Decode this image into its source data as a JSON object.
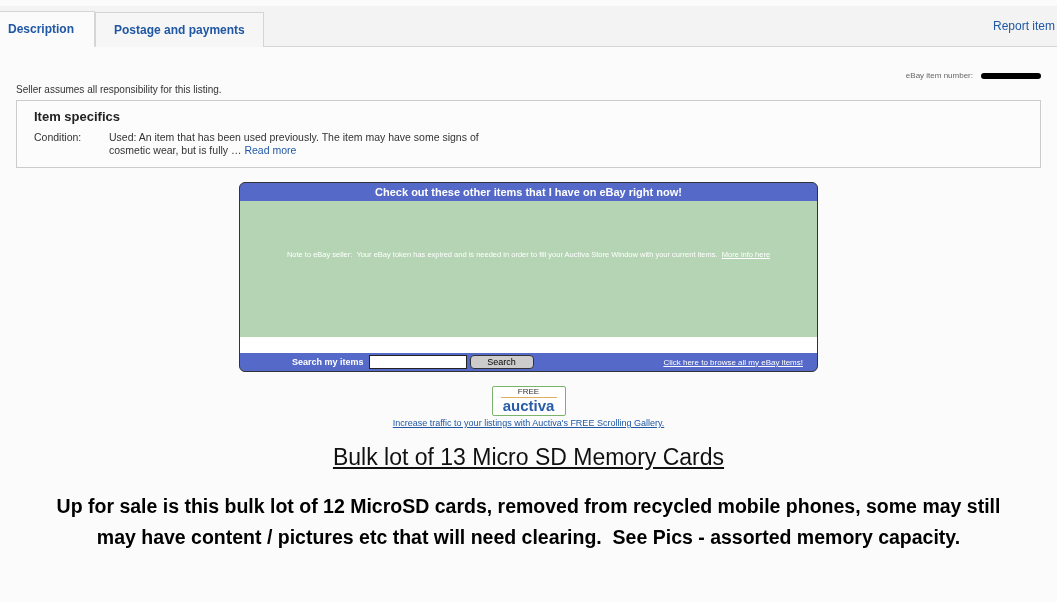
{
  "tabs": [
    {
      "label": "Description",
      "selected": true
    },
    {
      "label": "Postage and payments",
      "selected": false
    }
  ],
  "report_link": "Report item",
  "item_number_label": "eBay item number:",
  "seller_note": "Seller assumes all responsibility for this listing.",
  "item_specifics": {
    "title": "Item specifics",
    "rows": [
      {
        "label": "Condition:",
        "value": "Used: An item that has been used previously. The item may have some signs of cosmetic wear, but is fully …",
        "link": "Read more"
      }
    ]
  },
  "store_window": {
    "title": "Check out these other items that I have on eBay right now!",
    "note": "Note to eBay seller:  Your eBay token has expired and is needed in order to fill your Auctiva Store Window with your current items.",
    "note_link": "More info here",
    "search_label": "Search my items",
    "search_button": "Search",
    "browse_link": "Click here to browse all my eBay items!"
  },
  "auctiva_badge": {
    "top": "FREE",
    "bottom": "auctiva"
  },
  "auctiva_link": "Increase traffic to your listings with Auctiva's FREE Scrolling Gallery.",
  "listing_title": "Bulk lot of 13 Micro SD Memory Cards",
  "listing_description": "Up for sale is this bulk lot of 12 MicroSD cards, removed from recycled mobile phones, some may still may have content / pictures etc that will need clearing.  See Pics - assorted memory capacity."
}
